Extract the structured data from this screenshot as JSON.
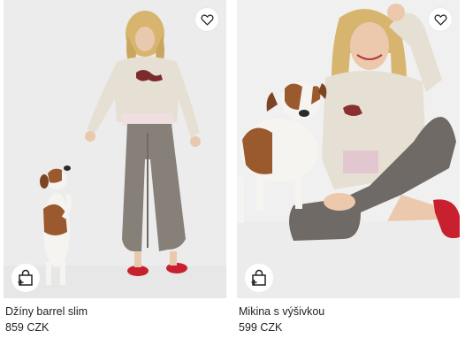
{
  "products": [
    {
      "name": "Džíny barrel slim",
      "price": "859 CZK",
      "wishlist_icon": "heart-icon",
      "add_to_bag_icon": "shopping-bag-plus-icon",
      "photo": "model-with-jack-russell-dog-standing"
    },
    {
      "name": "Mikina s výšivkou",
      "price": "599 CZK",
      "wishlist_icon": "heart-icon",
      "add_to_bag_icon": "shopping-bag-plus-icon",
      "photo": "model-sitting-with-jack-russell-dog"
    }
  ],
  "colors": {
    "background": "#ffffff",
    "photo_bg_left": "#ececec",
    "photo_bg_right": "#f0f0f0",
    "text": "#222222",
    "shoes": "#c8202e"
  }
}
